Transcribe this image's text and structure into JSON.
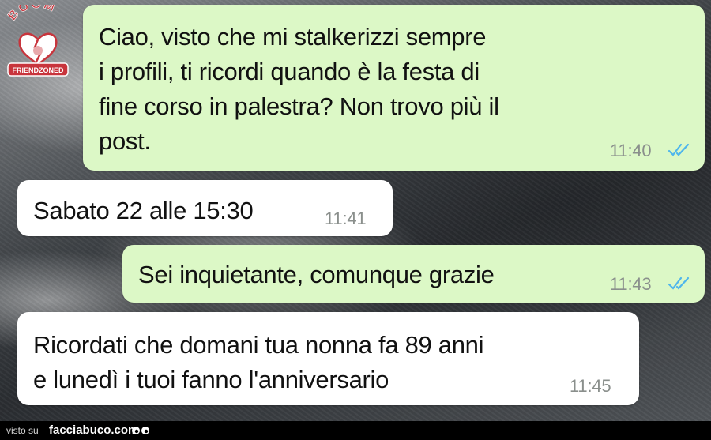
{
  "logo": {
    "top_text": "BOOM",
    "banner_text": "FRIENDZONED",
    "icon": "broken-heart-icon"
  },
  "messages": [
    {
      "direction": "outgoing",
      "text": "Ciao, visto che mi stalkerizzi sempre\ni profili, ti ricordi quando è la festa di\nfine corso in palestra? Non trovo più il\npost.",
      "time": "11:40",
      "status_icon": "double-check-read-icon"
    },
    {
      "direction": "incoming",
      "text": "Sabato 22 alle 15:30",
      "time": "11:41"
    },
    {
      "direction": "outgoing",
      "text": "Sei inquietante, comunque grazie",
      "time": "11:43",
      "status_icon": "double-check-read-icon"
    },
    {
      "direction": "incoming",
      "text": "Ricordati che domani tua nonna fa 89 anni\ne lunedì i tuoi fanno l'anniversario",
      "time": "11:45"
    }
  ],
  "footer": {
    "prefix": "visto su",
    "site": "facciabuco.com",
    "icon": "eyes-icon"
  },
  "colors": {
    "outgoing_bubble": "#dcf8c6",
    "incoming_bubble": "#ffffff",
    "read_check": "#4fb6ec",
    "timestamp": "#8a8f8c",
    "logo_red": "#c8343c"
  }
}
